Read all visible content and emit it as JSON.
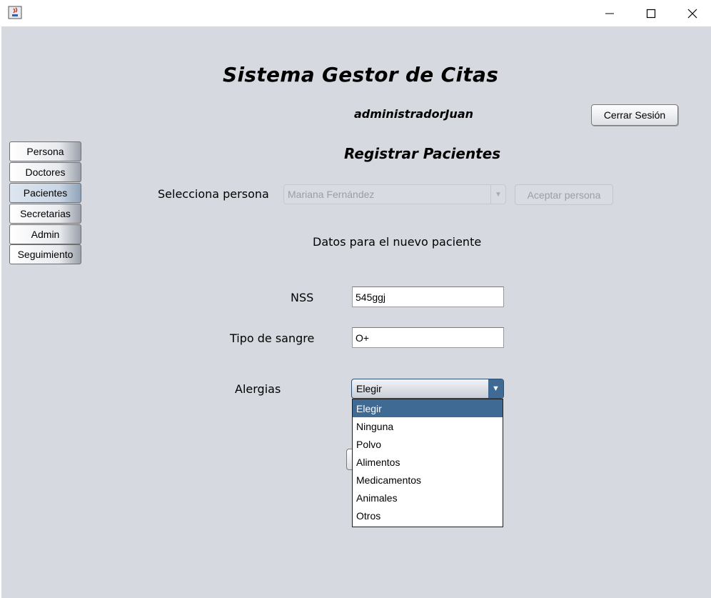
{
  "window": {
    "app_icon": "java-cup-icon",
    "controls": [
      "minimize-icon",
      "maximize-icon",
      "close-icon"
    ]
  },
  "header": {
    "title": "Sistema Gestor de Citas",
    "user": "administradorJuan",
    "logout_label": "Cerrar Sesión"
  },
  "sidebar": {
    "items": [
      {
        "label": "Persona"
      },
      {
        "label": "Doctores"
      },
      {
        "label": "Pacientes"
      },
      {
        "label": "Secretarias"
      },
      {
        "label": "Admin"
      },
      {
        "label": "Seguimiento"
      }
    ],
    "active": "Pacientes"
  },
  "form": {
    "section_title": "Registrar Pacientes",
    "select_person_label": "Selecciona persona",
    "select_person_value": "Mariana Fernández",
    "accept_person_label": "Aceptar persona",
    "subtitle": "Datos para el nuevo paciente",
    "nss_label": "NSS",
    "nss_value": "545ggj",
    "blood_label": "Tipo de sangre",
    "blood_value": "O+",
    "allergies_label": "Alergias",
    "allergies_value": "Elegir",
    "allergies_options": [
      "Elegir",
      "Ninguna",
      "Polvo",
      "Alimentos",
      "Medicamentos",
      "Animales",
      "Otros"
    ],
    "allergies_selected_index": 0
  },
  "colors": {
    "background": "#d6d9e0",
    "selection": "#3e6a93"
  }
}
